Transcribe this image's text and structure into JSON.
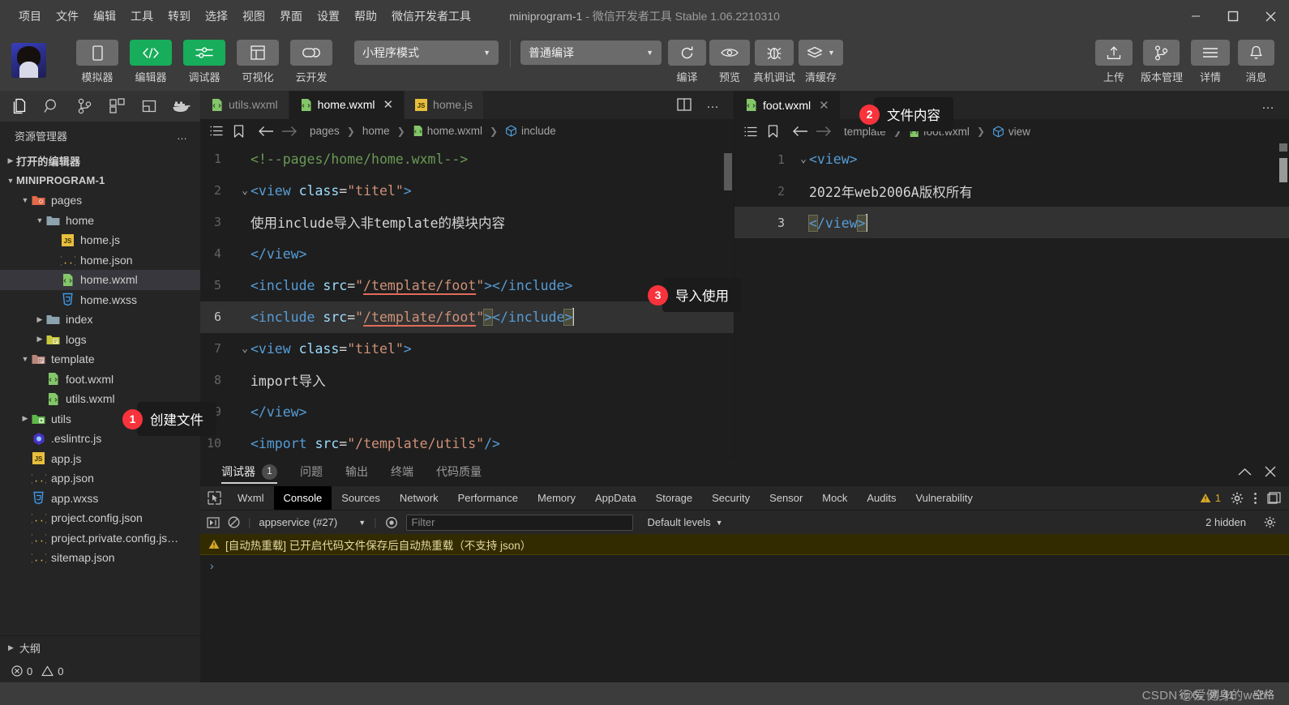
{
  "titlebar": {
    "menus": [
      "项目",
      "文件",
      "编辑",
      "工具",
      "转到",
      "选择",
      "视图",
      "界面",
      "设置",
      "帮助",
      "微信开发者工具"
    ],
    "project_name": "miniprogram-1",
    "title_rest": " -  微信开发者工具 Stable 1.06.2210310",
    "minimize": "–",
    "maximize": "□",
    "close": "✕"
  },
  "toolbar": {
    "left_buttons": [
      {
        "label": "模拟器",
        "icon": "phone-icon",
        "accent": false
      },
      {
        "label": "编辑器",
        "icon": "code-icon",
        "accent": true
      },
      {
        "label": "调试器",
        "icon": "sliders-icon",
        "accent": true
      },
      {
        "label": "可视化",
        "icon": "layout-icon",
        "accent": false
      },
      {
        "label": "云开发",
        "icon": "cloud-icon",
        "accent": false
      }
    ],
    "mode_select": "小程序模式",
    "compile_select": "普通编译",
    "action_buttons": [
      {
        "label": "编译",
        "icon": "refresh-icon"
      },
      {
        "label": "预览",
        "icon": "eye-icon"
      },
      {
        "label": "真机调试",
        "icon": "bug-icon"
      },
      {
        "label": "清缓存",
        "icon": "layers-icon"
      }
    ],
    "right_buttons": [
      {
        "label": "上传",
        "icon": "upload-icon"
      },
      {
        "label": "版本管理",
        "icon": "branch-icon"
      },
      {
        "label": "详情",
        "icon": "menu-icon"
      },
      {
        "label": "消息",
        "icon": "bell-icon"
      }
    ],
    "accent_color": "#17ad5a"
  },
  "activitybar": {
    "icons": [
      "files-icon",
      "search-icon",
      "source-control-icon",
      "extensions-icon",
      "layout-panel-icon",
      "docker-icon"
    ]
  },
  "explorer": {
    "title": "资源管理器",
    "more": "…",
    "open_editors": "打开的编辑器",
    "root": "MINIPROGRAM-1",
    "tree": [
      {
        "label": "pages",
        "indent": 1,
        "type": "folder-pages",
        "twisty": "down",
        "selected": false
      },
      {
        "label": "home",
        "indent": 2,
        "type": "folder",
        "twisty": "down",
        "selected": false
      },
      {
        "label": "home.js",
        "indent": 3,
        "type": "js",
        "twisty": "",
        "selected": false
      },
      {
        "label": "home.json",
        "indent": 3,
        "type": "json",
        "twisty": "",
        "selected": false
      },
      {
        "label": "home.wxml",
        "indent": 3,
        "type": "wxml",
        "twisty": "",
        "selected": true
      },
      {
        "label": "home.wxss",
        "indent": 3,
        "type": "wxss",
        "twisty": "",
        "selected": false
      },
      {
        "label": "index",
        "indent": 2,
        "type": "folder",
        "twisty": "right",
        "selected": false
      },
      {
        "label": "logs",
        "indent": 2,
        "type": "folder-logs",
        "twisty": "right",
        "selected": false
      },
      {
        "label": "template",
        "indent": 1,
        "type": "folder-tpl",
        "twisty": "down",
        "selected": false
      },
      {
        "label": "foot.wxml",
        "indent": 2,
        "type": "wxml",
        "twisty": "",
        "selected": false
      },
      {
        "label": "utils.wxml",
        "indent": 2,
        "type": "wxml",
        "twisty": "",
        "selected": false
      },
      {
        "label": "utils",
        "indent": 1,
        "type": "folder-utils",
        "twisty": "right",
        "selected": false
      },
      {
        "label": ".eslintrc.js",
        "indent": 1,
        "type": "eslint",
        "twisty": "",
        "selected": false
      },
      {
        "label": "app.js",
        "indent": 1,
        "type": "js",
        "twisty": "",
        "selected": false
      },
      {
        "label": "app.json",
        "indent": 1,
        "type": "json",
        "twisty": "",
        "selected": false
      },
      {
        "label": "app.wxss",
        "indent": 1,
        "type": "wxss",
        "twisty": "",
        "selected": false
      },
      {
        "label": "project.config.json",
        "indent": 1,
        "type": "json",
        "twisty": "",
        "selected": false
      },
      {
        "label": "project.private.config.js…",
        "indent": 1,
        "type": "json",
        "twisty": "",
        "selected": false
      },
      {
        "label": "sitemap.json",
        "indent": 1,
        "type": "json",
        "twisty": "",
        "selected": false
      }
    ],
    "outline": "大纲",
    "errors": "0",
    "warnings": "0"
  },
  "left_editor": {
    "tabs": [
      {
        "label": "utils.wxml",
        "icon": "wxml",
        "active": false,
        "closable": false
      },
      {
        "label": "home.wxml",
        "icon": "wxml",
        "active": true,
        "closable": true
      },
      {
        "label": "home.js",
        "icon": "js",
        "active": false,
        "closable": false
      }
    ],
    "close_glyph": "✕",
    "breadcrumb": [
      "pages",
      "home",
      "home.wxml",
      "include"
    ],
    "lines": [
      {
        "num": "1",
        "fold": "",
        "active": false
      },
      {
        "num": "2",
        "fold": "v",
        "active": false
      },
      {
        "num": "3",
        "fold": "",
        "active": false
      },
      {
        "num": "4",
        "fold": "",
        "active": false
      },
      {
        "num": "5",
        "fold": "",
        "active": false
      },
      {
        "num": "6",
        "fold": "",
        "active": true
      },
      {
        "num": "7",
        "fold": "v",
        "active": false
      },
      {
        "num": "8",
        "fold": "",
        "active": false
      },
      {
        "num": "9",
        "fold": "",
        "active": false
      },
      {
        "num": "10",
        "fold": "",
        "active": false
      }
    ],
    "code_text": [
      "<!--pages/home/home.wxml-->",
      "<view class=\"titel\">",
      "使用include导入非template的模块内容",
      "</view>",
      "<include src=\"/template/foot\"></include>",
      "<include src=\"/template/foot\"></include>",
      "<view class=\"titel\">",
      "import导入",
      "</view>",
      "<import src=\"/template/utils\"/>"
    ]
  },
  "right_editor": {
    "tabs": [
      {
        "label": "foot.wxml",
        "icon": "wxml",
        "active": true,
        "closable": true
      }
    ],
    "close_glyph": "✕",
    "breadcrumb": [
      "template",
      "foot.wxml",
      "view"
    ],
    "lines": [
      {
        "num": "1",
        "fold": "v",
        "active": false
      },
      {
        "num": "2",
        "fold": "",
        "active": false
      },
      {
        "num": "3",
        "fold": "",
        "active": true
      }
    ],
    "code_text": [
      "<view>",
      "2022年web2006A版权所有",
      "</view>"
    ]
  },
  "callouts": [
    {
      "num": "1",
      "text": "创建文件"
    },
    {
      "num": "2",
      "text": "文件内容"
    },
    {
      "num": "3",
      "text": "导入使用"
    }
  ],
  "debugger_panel": {
    "tabs": [
      {
        "label": "调试器",
        "badge": "1",
        "active": true
      },
      {
        "label": "问题",
        "badge": "",
        "active": false
      },
      {
        "label": "输出",
        "badge": "",
        "active": false
      },
      {
        "label": "终端",
        "badge": "",
        "active": false
      },
      {
        "label": "代码质量",
        "badge": "",
        "active": false
      }
    ],
    "collapse_icon": "chevron-up-icon",
    "close_icon": "close-icon"
  },
  "devtools": {
    "tabs": [
      "Wxml",
      "Console",
      "Sources",
      "Network",
      "Performance",
      "Memory",
      "AppData",
      "Storage",
      "Security",
      "Sensor",
      "Mock",
      "Audits",
      "Vulnerability"
    ],
    "active_tab": "Console",
    "warning_count": "1",
    "inspect_icon": "inspect-icon",
    "settings_icon": "gear-icon",
    "more_icon": "kebab-icon",
    "dock_icon": "dock-icon",
    "filter": {
      "play_icon": "step-icon",
      "clear_icon": "clear-icon",
      "context": "appservice (#27)",
      "eye_icon": "eye-icon",
      "placeholder": "Filter",
      "levels": "Default levels",
      "hidden_text": "2 hidden",
      "hidden_gear": "gear-icon"
    },
    "messages": [
      {
        "type": "warning",
        "text": "[自动热重载] 已开启代码文件保存后自动热重载（不支持 json）"
      }
    ],
    "prompt": "›"
  },
  "statusbar": {
    "cursor": "行 6，列 41",
    "spaces": "空格",
    "watermark": "CSDN @爱健身的web"
  }
}
